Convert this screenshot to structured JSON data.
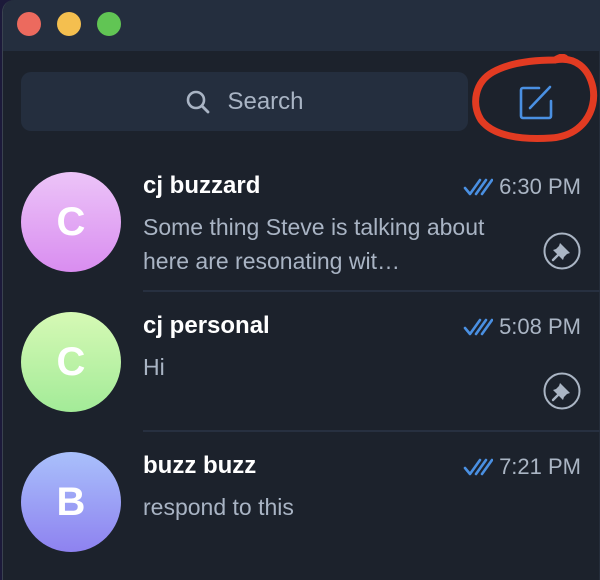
{
  "window": {
    "controls": [
      "close",
      "minimize",
      "zoom"
    ]
  },
  "search": {
    "placeholder": "Search",
    "icon": "search-icon"
  },
  "compose": {
    "icon": "compose-icon",
    "annotated": true
  },
  "chats": [
    {
      "initial": "C",
      "name": "cj buzzard",
      "time": "6:30 PM",
      "preview": "Some thing Steve is talking about here are resonating wit…",
      "read": true,
      "pinned": true,
      "avatar_colors": [
        "#ecc4f8",
        "#d98df0"
      ]
    },
    {
      "initial": "C",
      "name": "cj personal",
      "time": "5:08 PM",
      "preview": "Hi",
      "read": true,
      "pinned": true,
      "avatar_colors": [
        "#d6f9b5",
        "#a3eb98"
      ]
    },
    {
      "initial": "B",
      "name": "buzz buzz",
      "time": "7:21 PM",
      "preview": "respond to this",
      "read": true,
      "pinned": false,
      "avatar_colors": [
        "#a9c0fb",
        "#8e82f0"
      ]
    }
  ],
  "colors": {
    "accent": "#4a90e2",
    "annotation": "#e23b22"
  }
}
